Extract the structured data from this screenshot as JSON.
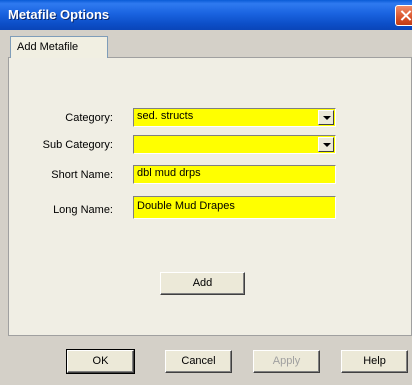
{
  "window": {
    "title": "Metafile Options"
  },
  "tabs": [
    {
      "label": "Add Metafile"
    }
  ],
  "form": {
    "category": {
      "label": "Category:",
      "value": "sed. structs"
    },
    "sub_category": {
      "label": "Sub Category:",
      "value": ""
    },
    "short_name": {
      "label": "Short Name:",
      "value": "dbl mud drps"
    },
    "long_name": {
      "label": "Long Name:",
      "value": "Double Mud Drapes"
    },
    "add_label": "Add"
  },
  "footer": {
    "ok_label": "OK",
    "cancel_label": "Cancel",
    "apply_label": "Apply",
    "help_label": "Help"
  },
  "colors": {
    "field_highlight": "#ffff00",
    "titlebar": "#0a5bd6"
  }
}
